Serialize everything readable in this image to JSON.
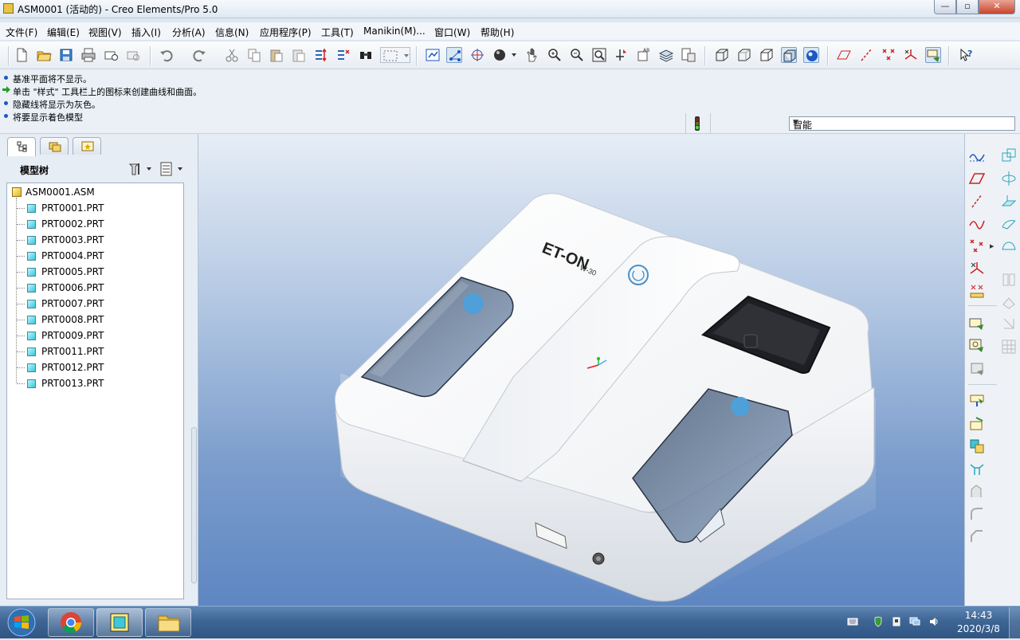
{
  "window": {
    "title": "ASM0001 (活动的) - Creo Elements/Pro 5.0",
    "minimize": "—",
    "maximize": "▫",
    "close": "✕"
  },
  "menu": {
    "items": [
      "文件(F)",
      "编辑(E)",
      "视图(V)",
      "插入(I)",
      "分析(A)",
      "信息(N)",
      "应用程序(P)",
      "工具(T)",
      "Manikin(M)...",
      "窗口(W)",
      "帮助(H)"
    ]
  },
  "messages": [
    "基准平面将不显示。",
    "单击 \"样式\" 工具栏上的图标来创建曲线和曲面。",
    "隐藏线将显示为灰色。",
    "将要显示着色模型"
  ],
  "filter": {
    "selected": "智能"
  },
  "model_tree": {
    "label": "模型树",
    "root": "ASM0001.ASM",
    "parts": [
      "PRT0001.PRT",
      "PRT0002.PRT",
      "PRT0003.PRT",
      "PRT0004.PRT",
      "PRT0005.PRT",
      "PRT0006.PRT",
      "PRT0007.PRT",
      "PRT0008.PRT",
      "PRT0009.PRT",
      "PRT0011.PRT",
      "PRT0012.PRT",
      "PRT0013.PRT"
    ]
  },
  "model": {
    "brand_text": "ET-ON",
    "model_text": "W-30"
  },
  "taskbar": {
    "time": "14:43",
    "date": "2020/3/8"
  },
  "colors": {
    "accent": "#1c59c2",
    "model_body": "#f4f5f7",
    "viewport_top": "#e6edf6",
    "viewport_bottom": "#5e86c2",
    "part_icon": "#35c7d8"
  }
}
